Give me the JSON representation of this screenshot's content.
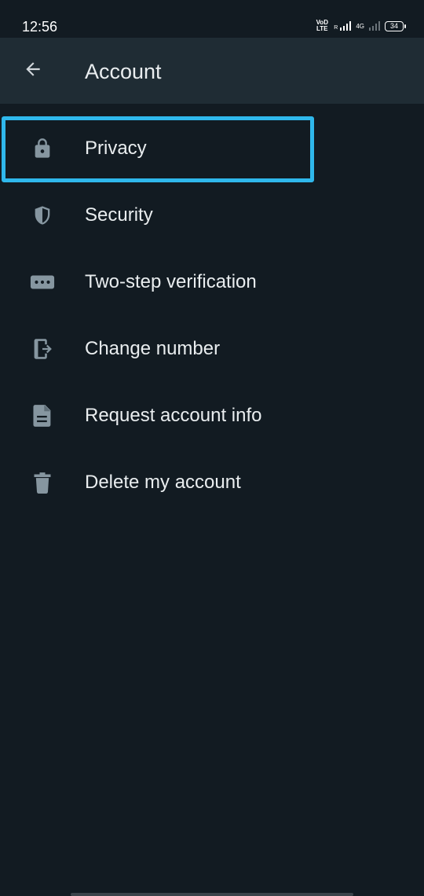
{
  "status_bar": {
    "time": "12:56",
    "volte": "VoD LTE",
    "roaming": "R",
    "network": "4G",
    "battery": "34"
  },
  "app_bar": {
    "back_icon": "arrow-left-icon",
    "title": "Account"
  },
  "colors": {
    "background": "#121b22",
    "app_bar": "#1f2c34",
    "text": "#e9edef",
    "icon": "#8696a0",
    "highlight": "#2fb8ec"
  },
  "menu": {
    "items": [
      {
        "label": "Privacy",
        "icon": "lock-icon"
      },
      {
        "label": "Security",
        "icon": "shield-icon"
      },
      {
        "label": "Two-step verification",
        "icon": "dots-password-icon"
      },
      {
        "label": "Change number",
        "icon": "phone-swap-icon"
      },
      {
        "label": "Request account info",
        "icon": "document-icon"
      },
      {
        "label": "Delete my account",
        "icon": "trash-icon"
      }
    ]
  }
}
